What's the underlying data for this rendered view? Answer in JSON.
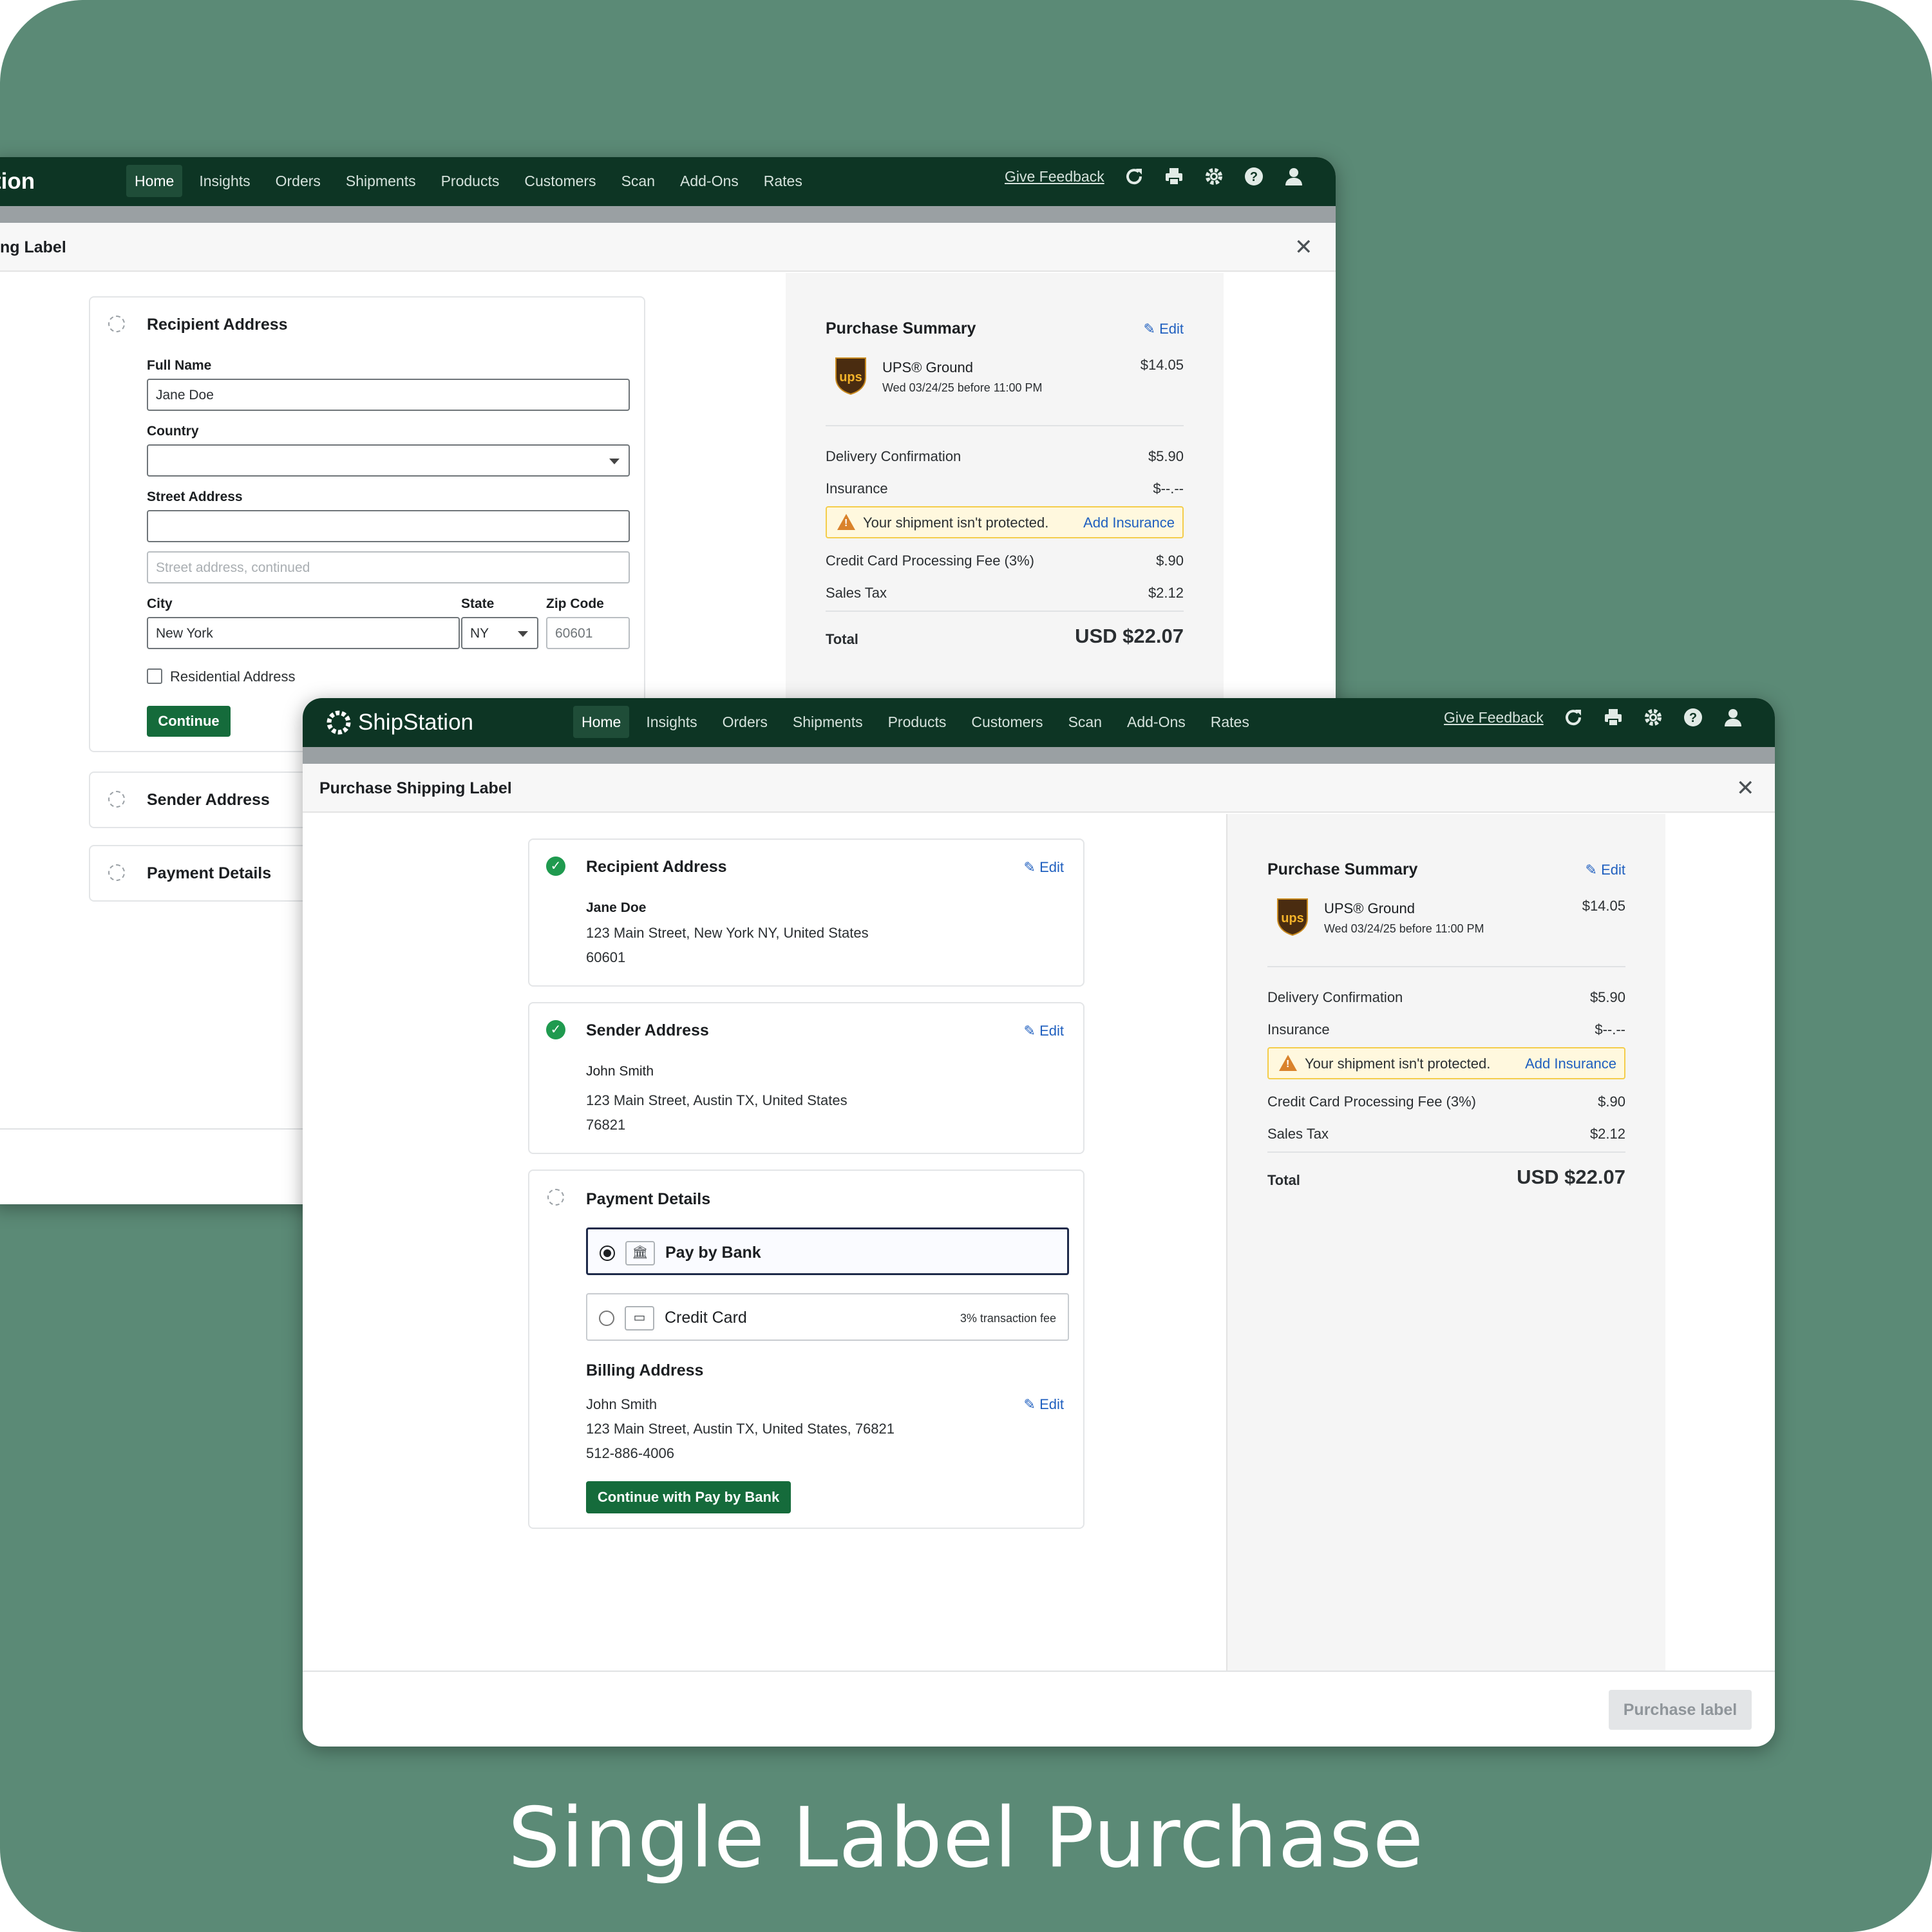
{
  "nav": {
    "logo_text": "ShipStation",
    "logo_partial": "tion",
    "items": [
      "Home",
      "Insights",
      "Orders",
      "Shipments",
      "Products",
      "Customers",
      "Scan",
      "Add-Ons",
      "Rates"
    ],
    "feedback": "Give Feedback",
    "icons": [
      "refresh-icon",
      "printer-icon",
      "gear-icon",
      "help-icon",
      "user-icon"
    ]
  },
  "back_dialog": {
    "title_partial": "ng Label",
    "close": "✕",
    "recipient": {
      "title": "Recipient Address",
      "full_name_label": "Full Name",
      "full_name_value": "Jane Doe",
      "country_label": "Country",
      "country_value": "",
      "street_label": "Street Address",
      "street_value": "",
      "street2_placeholder": "Street address, continued",
      "city_label": "City",
      "city_value": "New York",
      "state_label": "State",
      "state_value": "NY",
      "zip_label": "Zip Code",
      "zip_value": "60601",
      "residential_label": "Residential Address",
      "continue": "Continue"
    },
    "sender_title": "Sender Address",
    "payment_title": "Payment Details"
  },
  "summary": {
    "title": "Purchase Summary",
    "edit": "Edit",
    "service": "UPS® Ground",
    "delivery": "Wed 03/24/25 before 11:00 PM",
    "service_price": "$14.05",
    "rows": [
      {
        "label": "Delivery Confirmation",
        "value": "$5.90"
      },
      {
        "label": "Insurance",
        "value": "$--.--"
      }
    ],
    "warning": "Your shipment isn't protected.",
    "add_insurance": "Add Insurance",
    "rows2": [
      {
        "label": "Credit Card Processing Fee (3%)",
        "value": "$.90"
      },
      {
        "label": "Sales Tax",
        "value": "$2.12"
      }
    ],
    "total_label": "Total",
    "total_value": "USD $22.07",
    "carrier_logo": "ups"
  },
  "front_dialog": {
    "title": "Purchase Shipping Label",
    "close": "✕",
    "recipient": {
      "title": "Recipient Address",
      "edit": "Edit",
      "name": "Jane Doe",
      "line1": "123 Main Street, New York NY, United States",
      "line2": "60601"
    },
    "sender": {
      "title": "Sender Address",
      "edit": "Edit",
      "name": "John Smith",
      "line1": "123 Main Street, Austin TX, United States",
      "line2": "76821"
    },
    "payment": {
      "title": "Payment Details",
      "options": [
        {
          "label": "Pay by Bank",
          "selected": true,
          "fee": ""
        },
        {
          "label": "Credit Card",
          "selected": false,
          "fee": "3% transaction fee"
        }
      ],
      "billing_title": "Billing Address",
      "billing_name": "John Smith",
      "billing_line": "123 Main Street, Austin TX, United States, 76821",
      "billing_phone": "512-886-4006",
      "edit": "Edit",
      "continue": "Continue with Pay by Bank"
    },
    "purchase_button": "Purchase label"
  },
  "caption": "Single Label Purchase",
  "colors": {
    "background": "#5b8a76",
    "nav": "#0d3524",
    "primary_button": "#156b3b",
    "link": "#1f5fbf",
    "warning_bg": "#fff8de"
  }
}
